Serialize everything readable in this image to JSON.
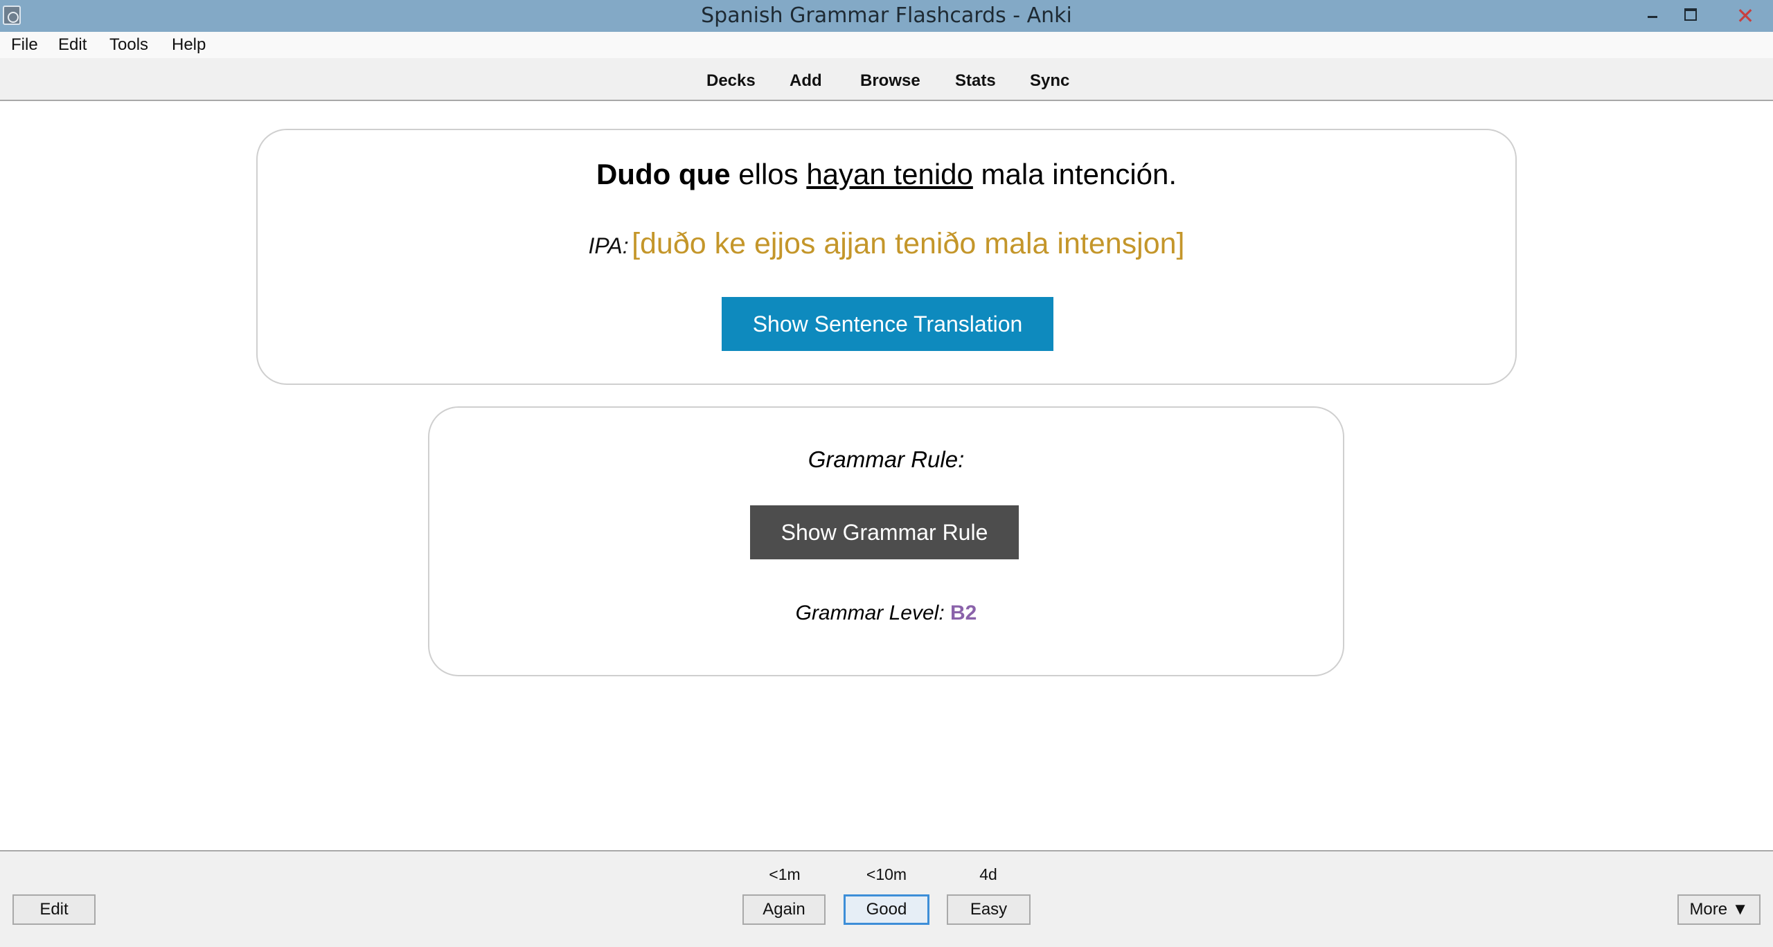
{
  "window": {
    "title": "Spanish Grammar Flashcards - Anki",
    "close_glyph": "✕"
  },
  "menu": {
    "items": [
      "File",
      "Edit",
      "Tools",
      "Help"
    ]
  },
  "toolbar": {
    "items": [
      "Decks",
      "Add",
      "Browse",
      "Stats",
      "Sync"
    ]
  },
  "card": {
    "sentence_bold": "Dudo que",
    "sentence_mid": "ellos",
    "sentence_underlined": "hayan tenido",
    "sentence_end": "mala intención.",
    "ipa_label": "IPA:",
    "ipa_text": "[duðo ke ejjos ajjan teniðo mala intensjon]",
    "translation_button": "Show Sentence Translation",
    "grammar_rule_label": "Grammar Rule:",
    "grammar_rule_button": "Show Grammar Rule",
    "grammar_level_label": "Grammar Level:",
    "grammar_level_value": "B2"
  },
  "colors": {
    "ipa": "#c4962a",
    "translation_button": "#0e8abe",
    "grammar_button": "#4d4d4d",
    "level": "#8a62aa"
  },
  "answer": {
    "edit_label": "Edit",
    "more_label": "More ▼",
    "buttons": [
      {
        "label": "Again",
        "interval": "<1m"
      },
      {
        "label": "Good",
        "interval": "<10m"
      },
      {
        "label": "Easy",
        "interval": "4d"
      }
    ]
  }
}
